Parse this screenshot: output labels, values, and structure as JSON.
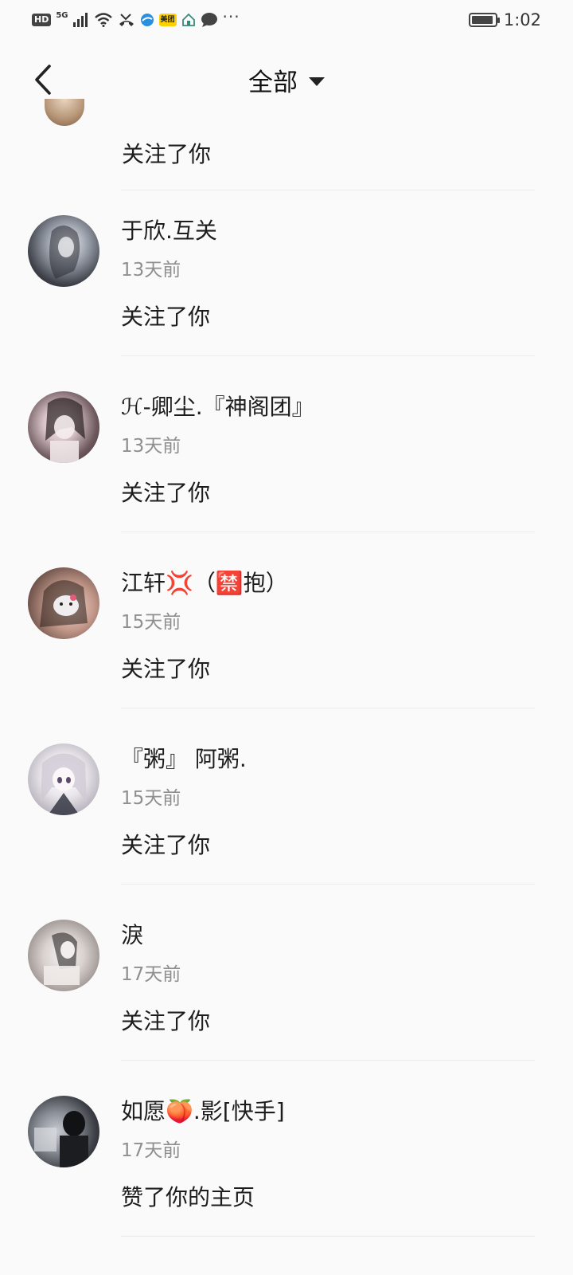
{
  "status_bar": {
    "hd": "HD",
    "network": "5G",
    "meituan": "美团",
    "more": "···",
    "battery_level": 0.95,
    "time": "1:02"
  },
  "nav": {
    "title": "全部"
  },
  "partial_item": {
    "action": "关注了你"
  },
  "items": [
    {
      "name": "于欣.互关",
      "time": "13天前",
      "action": "关注了你"
    },
    {
      "name": "ℋ-卿尘.『神阁团』",
      "time": "13天前",
      "action": "关注了你"
    },
    {
      "name": "江轩💢（🈲抱）",
      "time": "15天前",
      "action": "关注了你"
    },
    {
      "name": "『粥』 阿粥.",
      "time": "15天前",
      "action": "关注了你"
    },
    {
      "name": "淚",
      "time": "17天前",
      "action": "关注了你"
    },
    {
      "name": "如愿🍑.影[快手]",
      "time": "17天前",
      "action": "赞了你的主页"
    }
  ]
}
